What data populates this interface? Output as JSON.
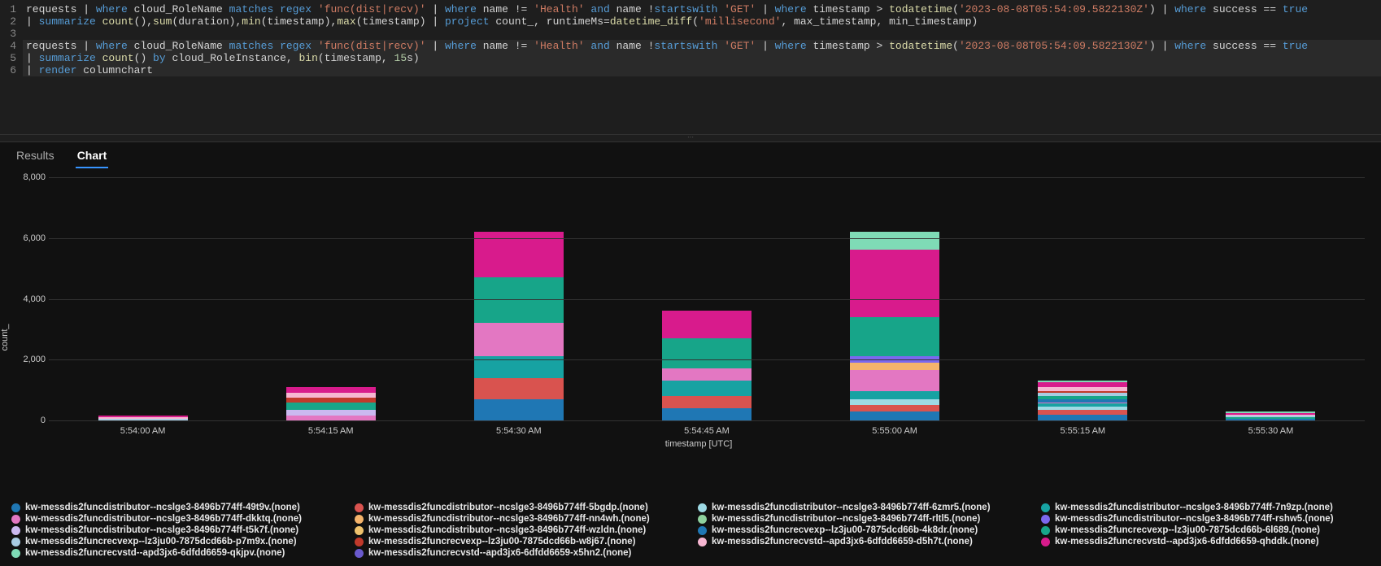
{
  "editor": {
    "line_numbers": [
      "1",
      "2",
      "3",
      "4",
      "5",
      "6"
    ],
    "lines": [
      [
        {
          "t": "requests ",
          "c": "tok-ident"
        },
        {
          "t": "| ",
          "c": "tok-pipe"
        },
        {
          "t": "where ",
          "c": "tok-keyword"
        },
        {
          "t": "cloud_RoleName ",
          "c": "tok-ident"
        },
        {
          "t": "matches regex ",
          "c": "tok-keyword"
        },
        {
          "t": "'func(dist|recv)' ",
          "c": "tok-string"
        },
        {
          "t": "| ",
          "c": "tok-pipe"
        },
        {
          "t": "where ",
          "c": "tok-keyword"
        },
        {
          "t": "name != ",
          "c": "tok-ident"
        },
        {
          "t": "'Health' ",
          "c": "tok-string"
        },
        {
          "t": "and ",
          "c": "tok-keyword"
        },
        {
          "t": "name !",
          "c": "tok-ident"
        },
        {
          "t": "startswith ",
          "c": "tok-keyword"
        },
        {
          "t": "'GET' ",
          "c": "tok-string"
        },
        {
          "t": "| ",
          "c": "tok-pipe"
        },
        {
          "t": "where ",
          "c": "tok-keyword"
        },
        {
          "t": "timestamp > ",
          "c": "tok-ident"
        },
        {
          "t": "todatetime",
          "c": "tok-func"
        },
        {
          "t": "(",
          "c": "tok-punct"
        },
        {
          "t": "'2023-08-08T05:54:09.5822130Z'",
          "c": "tok-string"
        },
        {
          "t": ") ",
          "c": "tok-punct"
        },
        {
          "t": "| ",
          "c": "tok-pipe"
        },
        {
          "t": "where ",
          "c": "tok-keyword"
        },
        {
          "t": "success == ",
          "c": "tok-ident"
        },
        {
          "t": "true",
          "c": "tok-keyword"
        }
      ],
      [
        {
          "t": "| ",
          "c": "tok-pipe"
        },
        {
          "t": "summarize ",
          "c": "tok-keyword"
        },
        {
          "t": "count",
          "c": "tok-func"
        },
        {
          "t": "(),",
          "c": "tok-punct"
        },
        {
          "t": "sum",
          "c": "tok-func"
        },
        {
          "t": "(duration),",
          "c": "tok-punct"
        },
        {
          "t": "min",
          "c": "tok-func"
        },
        {
          "t": "(timestamp),",
          "c": "tok-punct"
        },
        {
          "t": "max",
          "c": "tok-func"
        },
        {
          "t": "(timestamp) ",
          "c": "tok-punct"
        },
        {
          "t": "| ",
          "c": "tok-pipe"
        },
        {
          "t": "project ",
          "c": "tok-keyword"
        },
        {
          "t": "count_, runtimeMs=",
          "c": "tok-ident"
        },
        {
          "t": "datetime_diff",
          "c": "tok-func"
        },
        {
          "t": "(",
          "c": "tok-punct"
        },
        {
          "t": "'millisecond'",
          "c": "tok-string"
        },
        {
          "t": ", max_timestamp, min_timestamp)",
          "c": "tok-punct"
        }
      ],
      [],
      [
        {
          "t": "requests ",
          "c": "tok-ident"
        },
        {
          "t": "| ",
          "c": "tok-pipe"
        },
        {
          "t": "where ",
          "c": "tok-keyword"
        },
        {
          "t": "cloud_RoleName ",
          "c": "tok-ident"
        },
        {
          "t": "matches regex ",
          "c": "tok-keyword"
        },
        {
          "t": "'func(dist|recv)' ",
          "c": "tok-string"
        },
        {
          "t": "| ",
          "c": "tok-pipe"
        },
        {
          "t": "where ",
          "c": "tok-keyword"
        },
        {
          "t": "name != ",
          "c": "tok-ident"
        },
        {
          "t": "'Health' ",
          "c": "tok-string"
        },
        {
          "t": "and ",
          "c": "tok-keyword"
        },
        {
          "t": "name !",
          "c": "tok-ident"
        },
        {
          "t": "startswith ",
          "c": "tok-keyword"
        },
        {
          "t": "'GET' ",
          "c": "tok-string"
        },
        {
          "t": "| ",
          "c": "tok-pipe"
        },
        {
          "t": "where ",
          "c": "tok-keyword"
        },
        {
          "t": "timestamp > ",
          "c": "tok-ident"
        },
        {
          "t": "todatetime",
          "c": "tok-func"
        },
        {
          "t": "(",
          "c": "tok-punct"
        },
        {
          "t": "'2023-08-08T05:54:09.5822130Z'",
          "c": "tok-string"
        },
        {
          "t": ") ",
          "c": "tok-punct"
        },
        {
          "t": "| ",
          "c": "tok-pipe"
        },
        {
          "t": "where ",
          "c": "tok-keyword"
        },
        {
          "t": "success == ",
          "c": "tok-ident"
        },
        {
          "t": "true",
          "c": "tok-keyword"
        }
      ],
      [
        {
          "t": "| ",
          "c": "tok-pipe"
        },
        {
          "t": "summarize ",
          "c": "tok-keyword"
        },
        {
          "t": "count",
          "c": "tok-func"
        },
        {
          "t": "() ",
          "c": "tok-punct"
        },
        {
          "t": "by ",
          "c": "tok-keyword"
        },
        {
          "t": "cloud_RoleInstance, ",
          "c": "tok-ident"
        },
        {
          "t": "bin",
          "c": "tok-func"
        },
        {
          "t": "(timestamp, ",
          "c": "tok-punct"
        },
        {
          "t": "15",
          "c": "tok-num"
        },
        {
          "t": "s)",
          "c": "tok-punct"
        }
      ],
      [
        {
          "t": "| ",
          "c": "tok-pipe"
        },
        {
          "t": "render ",
          "c": "tok-keyword"
        },
        {
          "t": "columnchart",
          "c": "tok-ident"
        }
      ]
    ],
    "highlighted_lines": [
      3,
      4,
      5
    ]
  },
  "tabs": {
    "items": [
      {
        "label": "Results",
        "active": false
      },
      {
        "label": "Chart",
        "active": true
      }
    ]
  },
  "chart_data": {
    "type": "bar",
    "stacked": true,
    "xlabel": "timestamp [UTC]",
    "ylabel": "count_",
    "ylim": [
      0,
      8000
    ],
    "yticks": [
      0,
      2000,
      4000,
      6000,
      8000
    ],
    "ytick_labels": [
      "0",
      "2,000",
      "4,000",
      "6,000",
      "8,000"
    ],
    "categories": [
      "5:54:00 AM",
      "5:54:15 AM",
      "5:54:30 AM",
      "5:54:45 AM",
      "5:55:00 AM",
      "5:55:15 AM",
      "5:55:30 AM"
    ],
    "series": [
      {
        "name": "kw-messdis2funcdistributor--ncslge3-8496b774ff-49t9v.(none)",
        "color": "#1f77b4",
        "values": [
          0,
          0,
          700,
          400,
          300,
          200,
          0
        ]
      },
      {
        "name": "kw-messdis2funcdistributor--ncslge3-8496b774ff-5bgdp.(none)",
        "color": "#d9534f",
        "values": [
          0,
          0,
          700,
          400,
          200,
          150,
          0
        ]
      },
      {
        "name": "kw-messdis2funcdistributor--ncslge3-8496b774ff-6zmr5.(none)",
        "color": "#9edae5",
        "values": [
          0,
          0,
          0,
          0,
          200,
          100,
          0
        ]
      },
      {
        "name": "kw-messdis2funcdistributor--ncslge3-8496b774ff-7n9zp.(none)",
        "color": "#17a2a2",
        "values": [
          0,
          0,
          700,
          500,
          250,
          100,
          0
        ]
      },
      {
        "name": "kw-messdis2funcdistributor--ncslge3-8496b774ff-dkktq.(none)",
        "color": "#e377c2",
        "values": [
          0,
          150,
          1100,
          400,
          700,
          50,
          0
        ]
      },
      {
        "name": "kw-messdis2funcdistributor--ncslge3-8496b774ff-nn4wh.(none)",
        "color": "#f5b46b",
        "values": [
          0,
          0,
          0,
          0,
          250,
          0,
          0
        ]
      },
      {
        "name": "kw-messdis2funcdistributor--ncslge3-8496b774ff-rltl5.(none)",
        "color": "#8fd19e",
        "values": [
          0,
          0,
          0,
          0,
          0,
          0,
          0
        ]
      },
      {
        "name": "kw-messdis2funcdistributor--ncslge3-8496b774ff-rshw5.(none)",
        "color": "#7b68ee",
        "values": [
          0,
          0,
          0,
          0,
          200,
          0,
          0
        ]
      },
      {
        "name": "kw-messdis2funcdistributor--ncslge3-8496b774ff-t5k7f.(none)",
        "color": "#cbb9f0",
        "values": [
          0,
          200,
          0,
          0,
          0,
          0,
          0
        ]
      },
      {
        "name": "kw-messdis2funcdistributor--ncslge3-8496b774ff-wzldn.(none)",
        "color": "#f0c36d",
        "values": [
          0,
          0,
          0,
          0,
          0,
          0,
          0
        ]
      },
      {
        "name": "kw-messdis2funcrecvexp--lz3ju00-7875dcd66b-4k8dr.(none)",
        "color": "#1f77b4",
        "values": [
          0,
          0,
          0,
          0,
          0,
          100,
          50
        ]
      },
      {
        "name": "kw-messdis2funcrecvexp--lz3ju00-7875dcd66b-6l689.(none)",
        "color": "#17a589",
        "values": [
          0,
          250,
          1500,
          1000,
          1300,
          100,
          50
        ]
      },
      {
        "name": "kw-messdis2funcrecvexp--lz3ju00-7875dcd66b-p7m9x.(none)",
        "color": "#a9cce3",
        "values": [
          50,
          0,
          0,
          0,
          0,
          100,
          50
        ]
      },
      {
        "name": "kw-messdis2funcrecvexp--lz3ju00-7875dcd66b-w8j67.(none)",
        "color": "#c0392b",
        "values": [
          0,
          150,
          0,
          0,
          0,
          50,
          0
        ]
      },
      {
        "name": "kw-messdis2funcrecvstd--apd3jx6-6dfdd6659-d5h7t.(none)",
        "color": "#f7b6d2",
        "values": [
          50,
          150,
          0,
          0,
          0,
          150,
          50
        ]
      },
      {
        "name": "kw-messdis2funcrecvstd--apd3jx6-6dfdd6659-qhddk.(none)",
        "color": "#d81b8c",
        "values": [
          50,
          200,
          1500,
          900,
          2200,
          150,
          50
        ]
      },
      {
        "name": "kw-messdis2funcrecvstd--apd3jx6-6dfdd6659-qkjpv.(none)",
        "color": "#7fdbb6",
        "values": [
          0,
          0,
          0,
          0,
          600,
          50,
          50
        ]
      },
      {
        "name": "kw-messdis2funcrecvstd--apd3jx6-6dfdd6659-x5hn2.(none)",
        "color": "#6a5acd",
        "values": [
          0,
          0,
          0,
          0,
          0,
          0,
          0
        ]
      }
    ]
  }
}
